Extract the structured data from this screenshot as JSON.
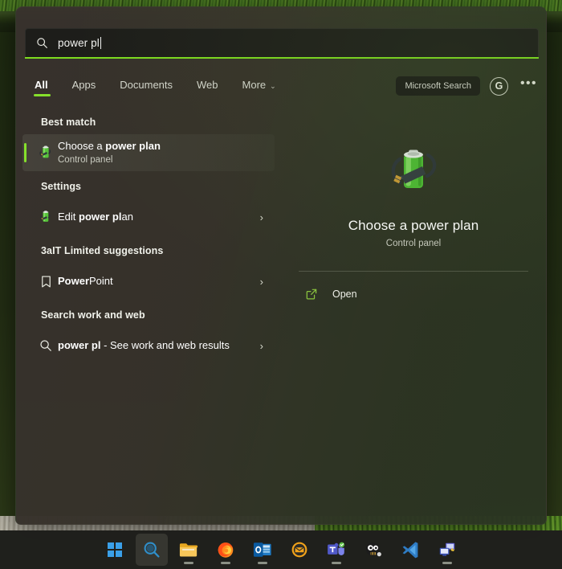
{
  "search": {
    "query": "power pl",
    "icon": "search-icon"
  },
  "tabs": [
    {
      "label": "All",
      "active": true
    },
    {
      "label": "Apps",
      "active": false
    },
    {
      "label": "Documents",
      "active": false
    },
    {
      "label": "Web",
      "active": false
    },
    {
      "label": "More",
      "active": false,
      "chevron": "⌄"
    }
  ],
  "header_right": {
    "ms_search_label": "Microsoft Search",
    "avatar_letter": "G",
    "overflow_label": "•••"
  },
  "sections": [
    {
      "header": "Best match",
      "items": [
        {
          "title_prefix": "Choose a ",
          "title_bold": "power plan",
          "title_suffix": "",
          "subtitle": "Control panel",
          "icon": "battery-plug-icon",
          "selected": true,
          "chevron": ""
        }
      ]
    },
    {
      "header": "Settings",
      "items": [
        {
          "title_prefix": "Edit ",
          "title_bold": "power pl",
          "title_suffix": "an",
          "subtitle": "",
          "icon": "battery-plug-icon",
          "selected": false,
          "chevron": "›"
        }
      ]
    },
    {
      "header": "3aIT Limited suggestions",
      "items": [
        {
          "title_prefix": "",
          "title_bold": "Power",
          "title_suffix": "Point",
          "subtitle": "",
          "icon": "bookmark-icon",
          "selected": false,
          "chevron": "›"
        }
      ]
    },
    {
      "header": "Search work and web",
      "items": [
        {
          "title_prefix": "",
          "title_bold": "power pl",
          "title_suffix": " - See work and web results",
          "subtitle": "",
          "icon": "search-icon",
          "selected": false,
          "chevron": "›"
        }
      ]
    }
  ],
  "preview": {
    "icon": "battery-plug-icon-large",
    "title": "Choose a power plan",
    "subtitle": "Control panel",
    "actions": [
      {
        "label": "Open",
        "icon": "open-external-icon"
      }
    ]
  },
  "taskbar": {
    "items": [
      {
        "name": "start-button",
        "icon": "windows-logo-icon",
        "active": false,
        "running": false,
        "badge": false
      },
      {
        "name": "search-button",
        "icon": "search-icon",
        "active": true,
        "running": false,
        "badge": false
      },
      {
        "name": "file-explorer-button",
        "icon": "folder-icon",
        "active": false,
        "running": true,
        "badge": false
      },
      {
        "name": "firefox-button",
        "icon": "firefox-icon",
        "active": false,
        "running": true,
        "badge": false
      },
      {
        "name": "outlook-button",
        "icon": "outlook-icon",
        "active": false,
        "running": true,
        "badge": false
      },
      {
        "name": "mail-button",
        "icon": "mail-circle-icon",
        "active": false,
        "running": false,
        "badge": false
      },
      {
        "name": "teams-button",
        "icon": "teams-icon",
        "active": false,
        "running": true,
        "badge": true
      },
      {
        "name": "app-button",
        "icon": "eyes-circle-icon",
        "active": false,
        "running": false,
        "badge": false
      },
      {
        "name": "vscode-button",
        "icon": "vscode-icon",
        "active": false,
        "running": false,
        "badge": false
      },
      {
        "name": "remote-desktop-button",
        "icon": "remote-desktop-icon",
        "active": false,
        "running": true,
        "badge": false
      }
    ]
  },
  "colors": {
    "accent_green": "#86e02b",
    "search_underline": "#7ddc1f",
    "panel_bg": "#38322d",
    "text_primary": "#ffffff",
    "text_secondary": "#c9cbc0"
  }
}
